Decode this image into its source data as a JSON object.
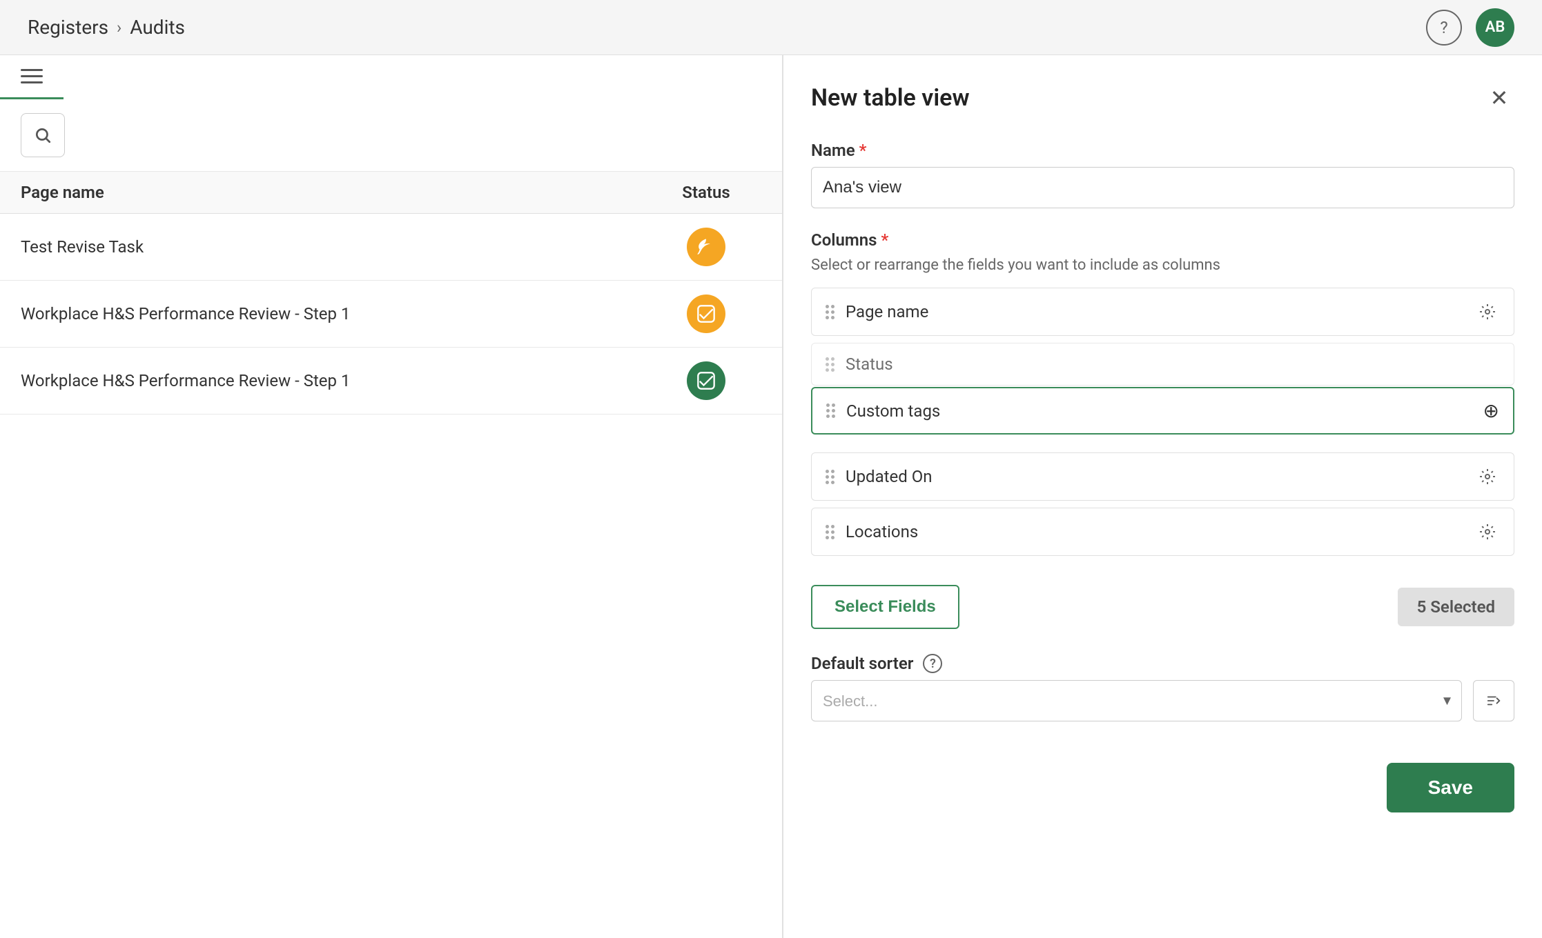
{
  "header": {
    "breadcrumb_registers": "Registers",
    "breadcrumb_separator": "›",
    "breadcrumb_audits": "Audits",
    "avatar_initials": "AB"
  },
  "left_panel": {
    "table_header_pagename": "Page name",
    "table_header_status": "Status",
    "rows": [
      {
        "name": "Test Revise Task",
        "status_type": "orange",
        "status_icon": "leaf"
      },
      {
        "name": "Workplace H&S Performance Review - Step 1",
        "status_type": "orange",
        "status_icon": "check"
      },
      {
        "name": "Workplace H&S Performance Review - Step 1",
        "status_type": "green",
        "status_icon": "check"
      }
    ]
  },
  "right_panel": {
    "title": "New table view",
    "name_label": "Name",
    "name_value": "Ana's view",
    "name_placeholder": "Ana's view",
    "columns_label": "Columns",
    "columns_subtitle": "Select or rearrange the fields you want to include as columns",
    "columns": [
      {
        "name": "Page name",
        "has_settings": true,
        "active": false
      },
      {
        "name": "Status",
        "has_settings": false,
        "active": false
      },
      {
        "name": "Custom tags",
        "has_settings": false,
        "active": true
      },
      {
        "name": "Updated On",
        "has_settings": true,
        "active": false
      },
      {
        "name": "Locations",
        "has_settings": true,
        "active": false
      }
    ],
    "select_fields_label": "Select Fields",
    "selected_count": "5 Selected",
    "default_sorter_label": "Default sorter",
    "sorter_placeholder": "Select...",
    "save_label": "Save"
  }
}
